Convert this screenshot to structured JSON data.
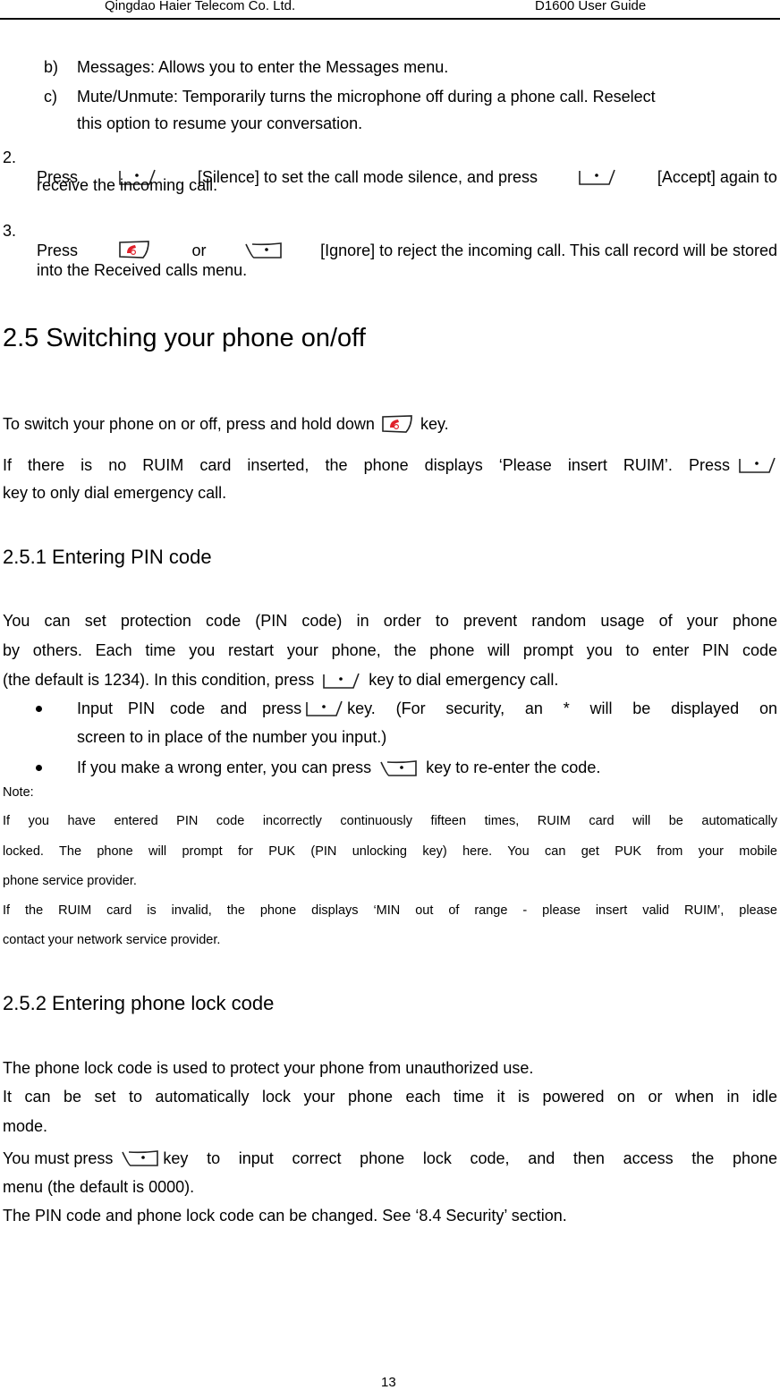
{
  "header": {
    "company": "Qingdao Haier Telecom Co. Ltd.",
    "doc": "D1600 User Guide"
  },
  "icons": {
    "left_soft_key": "left-soft-key-icon",
    "right_soft_key": "right-soft-key-icon",
    "end_key": "end-key-icon",
    "bullet": "bullet-icon"
  },
  "list_b": {
    "marker": "b)",
    "text": "Messages: Allows you to enter the Messages menu."
  },
  "list_c": {
    "marker": "c)",
    "line1": "Mute/Unmute: Temporarily turns the microphone off during a phone call. Reselect",
    "line2": "this option to resume your conversation."
  },
  "step2": {
    "marker": "2.",
    "a": "Press",
    "b": "[Silence] to set the call mode silence, and press",
    "c": "[Accept] again to",
    "line2": "receive the incoming call."
  },
  "step3": {
    "marker": "3.",
    "a": "Press",
    "b": "or",
    "c": "[Ignore] to reject the incoming call. This call record will be stored",
    "line2": "into the Received calls menu."
  },
  "section_2_5": {
    "title": "2.5 Switching your phone on/off",
    "p1a": "To switch your phone on or off, press and hold down",
    "p1b": "key.",
    "p2a": "If there is no RUIM card inserted, the phone displays ‘Please insert RUIM’. Press",
    "p2b": "key to only dial emergency call."
  },
  "section_2_5_1": {
    "title": "2.5.1 Entering PIN code",
    "p1": "You can set protection code (PIN code) in order to prevent random usage of your phone",
    "p2": "by others. Each time you restart your phone, the phone will prompt you to enter PIN code",
    "p3a": "(the default is 1234). In this condition, press",
    "p3b": "key to dial emergency call.",
    "bullet1a": "Input PIN code and press",
    "bullet1b": "key. (For security, an * will be displayed on",
    "bullet1c": "screen to in place of the number you input.)",
    "bullet2a": "If you make a wrong enter, you can press",
    "bullet2b": "key to re-enter the code.",
    "note_label": "Note:",
    "note1": "If you have entered PIN code incorrectly continuously fifteen times, RUIM card will be automatically",
    "note2": "locked. The phone will prompt for PUK (PIN unlocking key) here. You can get PUK from your mobile",
    "note3": "phone service provider.",
    "note4": "If the RUIM card is invalid, the phone displays ‘MIN out of range - please insert valid RUIM’, please",
    "note5": "contact your network service provider."
  },
  "section_2_5_2": {
    "title": "2.5.2 Entering phone lock code",
    "p1": "The phone lock code is used to protect your phone from unauthorized use.",
    "p2": "It can be set to automatically lock your phone each time it is powered on or when in idle",
    "p3": "mode.",
    "p4a": "You must press",
    "p4b": "key to input correct phone lock code, and then access the phone",
    "p5": "menu (the default is 0000).",
    "p6": "The PIN code and phone lock code can be changed. See ‘8.4 Security’ section."
  },
  "footer": {
    "page_number": "13"
  }
}
